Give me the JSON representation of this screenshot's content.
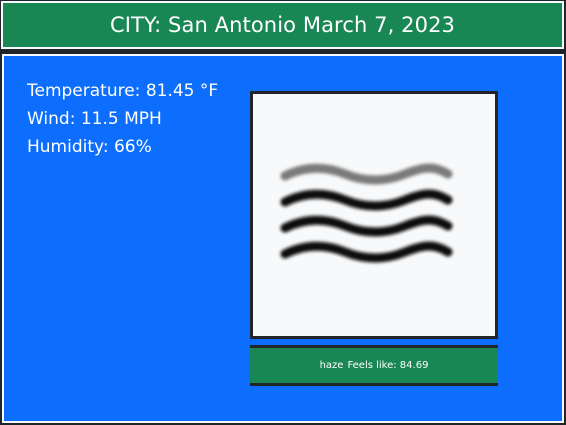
{
  "header": {
    "city_prefix": "CITY:",
    "city": "San Antonio",
    "date": "March 7, 2023"
  },
  "current": {
    "temperature": "Temperature: 81.45 °F",
    "wind": "Wind: 11.5 MPH",
    "humidity": "Humidity: 66%"
  },
  "condition": {
    "icon": "haze-icon",
    "description": "haze",
    "feels_like": "Feels like: 84.69"
  },
  "colors": {
    "header_bg": "#198754",
    "card_bg": "#0d6efd",
    "page_bg": "#212529",
    "icon_bg": "#f8f9fa"
  }
}
